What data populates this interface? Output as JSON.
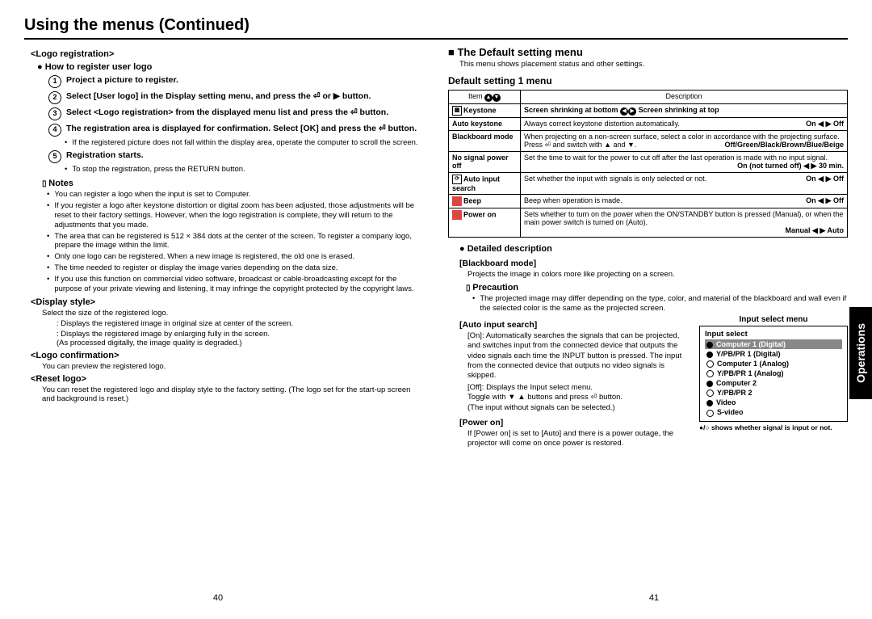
{
  "header": {
    "title": "Using the menus (Continued)"
  },
  "left": {
    "logo_reg": "<Logo registration>",
    "how_to": "How to register user logo",
    "step1": "Project a picture to register.",
    "step2": "Select [User logo] in the Display setting menu, and press the ⏎ or ▶ button.",
    "step3": "Select <Logo registration> from the displayed menu list and press the ⏎ button.",
    "step4": "The registration area is displayed for confirmation. Select [OK] and press the ⏎ button.",
    "step4_note": "If the registered picture does not fall within the display area, operate the computer to scroll the screen.",
    "step5": "Registration starts.",
    "step5_note": "To stop the registration, press the RETURN button.",
    "notes_head": "Notes",
    "notes": [
      "You can register a logo when the input is set to Computer.",
      "If you register a logo after keystone distortion or digital zoom has been adjusted, those adjustments will be reset to their factory settings. However, when the logo registration is complete, they will return to the adjustments that you made.",
      "The area that can be registered is 512 × 384 dots at the center of the screen. To register a company logo, prepare the image within the limit.",
      "Only one logo can be registered. When a new image is registered, the old one is erased.",
      "The time needed to register or display the image varies depending on the data size.",
      "If you use this function on commercial video software, broadcast or cable-broadcasting except for the purpose of your private viewing and listening, it may infringe the copyright protected by the copyright laws."
    ],
    "display_style": "<Display style>",
    "display_style_sub": "Select the size of the registered logo.",
    "ds1": ": Displays the registered image in original size at center of the screen.",
    "ds2": ": Displays the registered image by enlarging fully in the screen.",
    "ds2_paren": "(As processed digitally, the image quality is degraded.)",
    "logo_conf": "<Logo confirmation>",
    "logo_conf_sub": "You can preview the registered logo.",
    "reset_logo": "<Reset logo>",
    "reset_logo_sub": "You can reset the registered logo and display style to the factory setting. (The logo set for the start-up screen and background is reset.)"
  },
  "right": {
    "section_title": "The Default setting menu",
    "section_sub": "This menu shows placement status and other settings.",
    "subtitle": "Default setting 1 menu",
    "table_header": {
      "item": "Item",
      "desc": "Description"
    },
    "rows": {
      "keystone": {
        "label": "Keystone",
        "desc_left": "Screen shrinking at bottom",
        "desc_right": "Screen shrinking at top"
      },
      "auto_keystone": {
        "label": "Auto keystone",
        "desc": "Always correct keystone distortion automatically.",
        "right": "On ◀ ▶ Off"
      },
      "blackboard": {
        "label": "Blackboard mode",
        "desc1": "When projecting on a non-screen surface, select a color in accordance with the projecting surface.",
        "desc2_left": "Press ⏎ and switch with ▲ and ▼.",
        "desc2_right": "Off/Green/Black/Brown/Blue/Beige"
      },
      "nosignal": {
        "label": "No signal power off",
        "desc": "Set the time to wait for the power to cut off after the last operation is made with no input signal.",
        "right": "On (not turned off) ◀ ▶ 30 min."
      },
      "autoinput": {
        "label": "Auto input search",
        "desc": "Set whether the input with signals is only selected or not.",
        "right": "On ◀ ▶ Off"
      },
      "beep": {
        "label": "Beep",
        "desc": "Beep when operation is made.",
        "right": "On ◀ ▶ Off"
      },
      "poweron": {
        "label": "Power on",
        "desc": "Sets whether to turn on the power when the ON/STANDBY button is pressed (Manual), or when the main power switch is turned on (Auto).",
        "right": "Manual ◀ ▶ Auto"
      }
    },
    "detailed": "Detailed description",
    "blackboard_head": "[Blackboard mode]",
    "blackboard_body": "Projects the image in colors more like projecting on a screen.",
    "precaution": "Precaution",
    "precaution_text": "The projected image may differ depending on the type, color, and material of the blackboard and wall even if the selected color is the same as the projected screen.",
    "autoinput_head": "[Auto input search]",
    "autoinput_on": "[On]: Automatically searches the signals that can be projected, and switches input from the connected device that outputs the video signals each time the INPUT button is pressed. The input from the connected device that outputs no video signals is skipped.",
    "autoinput_off_label": "[Off]:",
    "autoinput_off_1": "Displays the Input select menu.",
    "autoinput_off_2": "Toggle with ▼ ▲ buttons and press ⏎ button.",
    "autoinput_off_3": "(The input without signals can be selected.)",
    "poweron_head": "[Power on]",
    "poweron_body": "If [Power on] is set to [Auto] and there is a power outage, the projector will come on once power is restored.",
    "input_menu": {
      "title": "Input select menu",
      "head": "Input select",
      "items": [
        {
          "mark": "filled",
          "label": "Computer 1 (Digital)",
          "sel": true
        },
        {
          "mark": "filled",
          "label": "Y/PB/PR 1 (Digital)"
        },
        {
          "mark": "empty",
          "label": "Computer 1 (Analog)"
        },
        {
          "mark": "empty",
          "label": "Y/PB/PR 1 (Analog)"
        },
        {
          "mark": "filled",
          "label": "Computer 2"
        },
        {
          "mark": "empty",
          "label": "Y/PB/PR 2"
        },
        {
          "mark": "filled",
          "label": "Video"
        },
        {
          "mark": "empty",
          "label": "S-video"
        }
      ],
      "note": "●/○ shows whether signal is input or not."
    }
  },
  "sidetab": "Operations",
  "pages": {
    "left": "40",
    "right": "41"
  }
}
